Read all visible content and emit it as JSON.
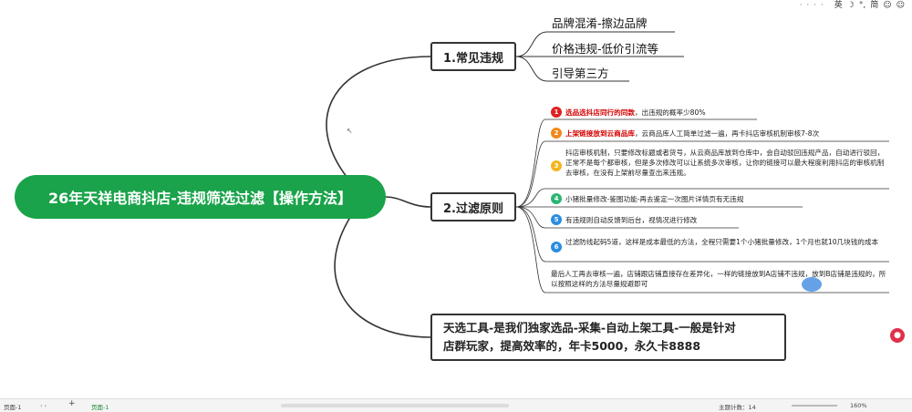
{
  "ime": {
    "dots": "· · · ·",
    "lang": "英",
    "moon": "☽",
    "punct": "°,",
    "simp": "简",
    "emoji1": "☺",
    "emoji2": "☺"
  },
  "root": {
    "title": "26年天祥电商抖店-违规筛选过滤【操作方法】"
  },
  "branch1": {
    "label": "1.常见违规",
    "leaves": [
      "品牌混淆-擦边品牌",
      "价格违规-低价引流等",
      "引导第三方"
    ]
  },
  "branch2": {
    "label": "2.过滤原则",
    "items": [
      {
        "n": "1",
        "color": "#e02020",
        "red": "选品选抖店同行的同款",
        "text": "，出违规的概率少80%"
      },
      {
        "n": "2",
        "color": "#f08a1c",
        "red": "上架链接放到云商品库",
        "text": "，云商品库人工简单过滤一遍，再卡抖店审核机制审核7-8次"
      },
      {
        "n": "3",
        "color": "#f2b51d",
        "red": "",
        "text": "抖店审核机制，只要修改标题或者货号，从云商品库放到仓库中，会自动驳回违规产品，自动进行驳回，正常不是每个都审核，但是多次修改可以让系统多次审核，让你的链接可以最大程度利用抖店的审核机制去审核，在没有上架前尽量查出来违规。"
      },
      {
        "n": "4",
        "color": "#2cb673",
        "red": "",
        "text": "小猪批量修改-鉴图功能-再去鉴定一次图片详情页有无违规"
      },
      {
        "n": "5",
        "color": "#2a8de0",
        "red": "",
        "text": "有违规则自动反馈到后台，视情况进行修改"
      },
      {
        "n": "6",
        "color": "#2a8de0",
        "red": "",
        "text": "过滤防线起码5道，这样是成本最低的方法，全程只需要1个小猪批量修改，1个月也就10几块钱的成本"
      }
    ],
    "last": "最后人工再去审核一遍，店铺跟店铺直接存在差异化，一样的链接放到A店铺不违规，放到B店铺是违规的，所以按照这样的方法尽量规避即可"
  },
  "branch3": {
    "line1": "天选工具-是我们独家选品-采集-自动上架工具-一般是针对",
    "line2": "店群玩家，提高效率的，年卡5000，永久卡8888"
  },
  "statusbar": {
    "page": "页面-1",
    "arrows": "‹ ›",
    "plus": "+",
    "sheet": "页面-1",
    "count": "主题计数：14",
    "zoom": "160%"
  },
  "colors": {
    "root": "#1aa34a",
    "line": "#333333"
  }
}
